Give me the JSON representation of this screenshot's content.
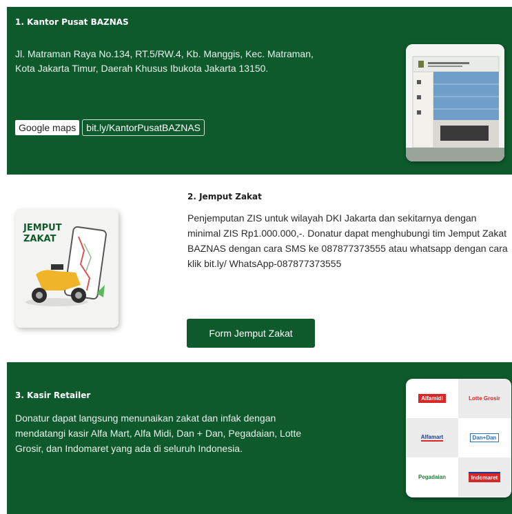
{
  "section1": {
    "title": "1. Kantor Pusat BAZNAS",
    "address": "Jl. Matraman Raya No.134, RT.5/RW.4, Kb. Manggis, Kec. Matraman, Kota Jakarta Timur, Daerah Khusus Ibukota Jakarta 13150.",
    "maps_label": "Google maps",
    "maps_link": "bit.ly/KantorPusatBAZNAS"
  },
  "section2": {
    "title": "2. Jemput Zakat",
    "image_text": [
      "JEMPUT",
      "ZAKAT"
    ],
    "description": "Penjemputan ZIS untuk wilayah DKI Jakarta dan sekitarnya dengan minimal ZIS Rp1.000.000,-. Donatur dapat menghubungi tim Jemput Zakat BAZNAS dengan cara SMS ke 087877373555 atau whatsapp dengan cara klik bit.ly/ WhatsApp-087877373555",
    "button_label": "Form Jemput Zakat"
  },
  "section3": {
    "title": "3. Kasir Retailer",
    "description": "Donatur dapat langsung menunaikan zakat dan infak dengan mendatangi kasir Alfa Mart, Alfa Midi, Dan + Dan, Pegadaian, Lotte Grosir, dan Indomaret yang ada di seluruh Indonesia.",
    "logos": [
      "Alfamidi",
      "Lotte Grosir",
      "Alfamart",
      "Dan+Dan",
      "Pegadaian",
      "Indomaret"
    ]
  },
  "colors": {
    "brand_green": "#0e5a2c",
    "white": "#ffffff",
    "text_dark": "#2b2b2b"
  },
  "icons": [
    "building-photo",
    "scooter-icon",
    "phone-map-icon",
    "retailer-logos"
  ]
}
